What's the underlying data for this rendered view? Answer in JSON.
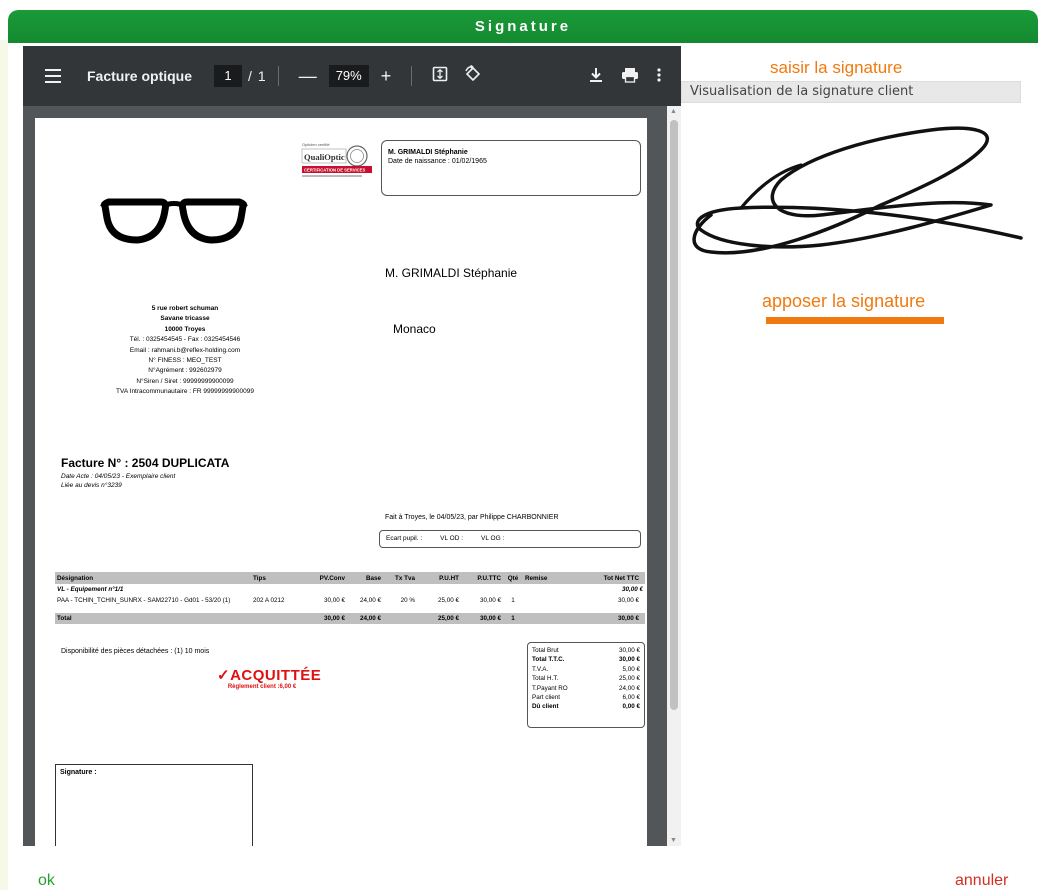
{
  "dialog": {
    "title": "Signature"
  },
  "toolbar": {
    "title": "Facture optique",
    "page_current": "1",
    "page_sep": "/",
    "page_total": "1",
    "zoom": "79%"
  },
  "invoice": {
    "patient_name": "M.  GRIMALDI Stéphanie",
    "patient_dob": "Date de naissance : 01/02/1965",
    "address_name": "M.  GRIMALDI Stéphanie",
    "address_city": "Monaco",
    "shop_lines": [
      "5 rue robert schuman",
      "Savane tricasse",
      "10000 Troyes",
      "Tél. : 0325454545 - Fax : 0325454546",
      "Email : rahmani.b@reflex-holding.com",
      "N° FINESS : MEO_TEST",
      "N°Agrément : 992602979",
      "N°Siren / Siret : 99999999900099",
      "TVA Intracommunautaire : FR 99999999900099"
    ],
    "title": "Facture N° : 2504  DUPLICATA",
    "sub1": "Date Acte : 04/05/23 - Exemplaire client",
    "sub2": "Liée au devis n°3239",
    "fait": "Fait à Troyes, le 04/05/23, par Philippe CHARBONNIER",
    "ecart": [
      "Ecart pupil.    :",
      "VL OD :",
      "VL OG :"
    ],
    "table_headers": [
      "Désignation",
      "Tips",
      "PV.Conv",
      "Base",
      "Tx Tva",
      "P.U.HT",
      "P.U.TTC",
      "Qté",
      "Remise",
      "Tot Net TTC"
    ],
    "group_label": "VL - Equipement n°1/1",
    "group_total": "30,00 €",
    "item_row": [
      "PAA - TCHIN_TCHIN_SUNRX - SAM22710 - Gd01 - 53/20 (1)",
      "202 A 0212",
      "30,00 €",
      "24,00 €",
      "20 %",
      "25,00 €",
      "30,00 €",
      "1",
      "",
      "30,00 €"
    ],
    "total_row": [
      "Total",
      "",
      "30,00 €",
      "24,00 €",
      "",
      "25,00 €",
      "30,00 €",
      "1",
      "",
      "30,00 €"
    ],
    "dispo": "Disponibilité des pièces détachées :  (1) 10 mois",
    "acquittee": "ACQUITTÉE",
    "reglement": "Règlement client :6,00 €",
    "totals": [
      {
        "label": "Total Brut",
        "value": "30,00 €",
        "bold": false
      },
      {
        "label": "Total T.T.C.",
        "value": "30,00 €",
        "bold": true
      },
      {
        "label": "T.V.A.",
        "value": "5,00 €",
        "bold": false
      },
      {
        "label": "Total H.T.",
        "value": "25,00 €",
        "bold": false
      },
      {
        "label": "T.Payant RO",
        "value": "24,00 €",
        "bold": false
      },
      {
        "label": "Part client",
        "value": "6,00 €",
        "bold": false
      },
      {
        "label": "Dû client",
        "value": "0,00 €",
        "bold": true
      }
    ],
    "signature_label": "Signature :",
    "logo_text": "QualiOptic",
    "logo_small": "Opticien certifié",
    "logo_band": "CERTIFICATION DE SERVICES"
  },
  "right": {
    "saisir": "saisir la signature",
    "visu": "Visualisation de la signature client",
    "apposer": "apposer la signature"
  },
  "footer": {
    "ok": "ok",
    "annuler": "annuler"
  },
  "colors": {
    "green": "#148a30",
    "orange": "#f07a10",
    "red": "#d33020"
  }
}
